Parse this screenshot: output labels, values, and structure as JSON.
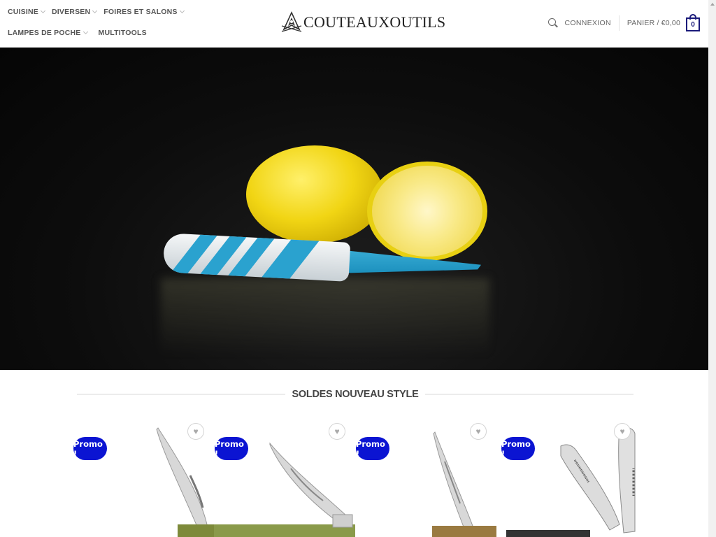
{
  "header": {
    "nav": [
      {
        "label": "CUISINE",
        "has_dropdown": true
      },
      {
        "label": "DIVERSEN",
        "has_dropdown": true
      },
      {
        "label": "FOIRES ET SALONS",
        "has_dropdown": true
      },
      {
        "label": "LAMPES DE POCHE",
        "has_dropdown": true
      },
      {
        "label": "MULTITOOLS",
        "has_dropdown": false
      }
    ],
    "logo_text": "COUTEAUXOUTILS",
    "login_label": "CONNEXION",
    "cart_label": "PANIER / €0,00",
    "cart_count": "0"
  },
  "hero": {
    "image_description": "Lemon and halved lemon with blue ceramic knife on dark background"
  },
  "section": {
    "title": "SOLDES NOUVEAU STYLE"
  },
  "products": [
    {
      "badge": "Promo !",
      "wishlist_icon": "heart-icon"
    },
    {
      "badge": "Promo !",
      "wishlist_icon": "heart-icon"
    },
    {
      "badge": "Promo !",
      "wishlist_icon": "heart-icon"
    },
    {
      "badge": "Promo !",
      "wishlist_icon": "heart-icon"
    }
  ],
  "colors": {
    "accent": "#0b14d2",
    "cart_border": "#1a1a7a",
    "text": "#555555"
  }
}
